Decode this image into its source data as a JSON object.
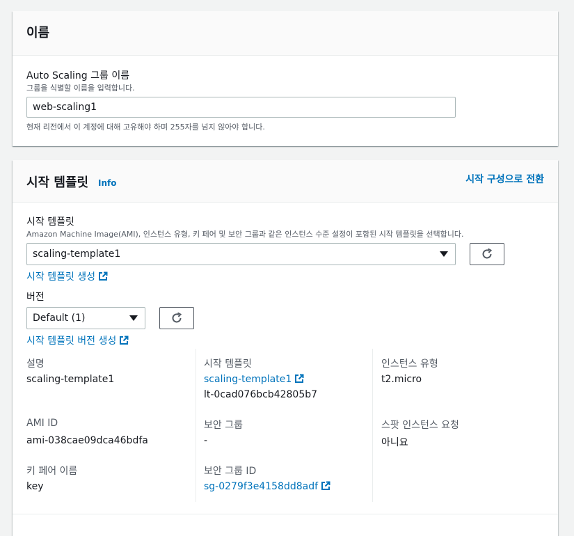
{
  "name_section": {
    "title": "이름",
    "asg_name_label": "Auto Scaling 그룹 이름",
    "asg_name_desc": "그룹을 식별할 이름을 입력합니다.",
    "asg_name_value": "web-scaling1",
    "asg_name_hint": "현재 리전에서 이 계정에 대해 고유해야 하며 255자를 넘지 않아야 합니다."
  },
  "template_section": {
    "title": "시작 템플릿",
    "info": "Info",
    "switch_link": "시작 구성으로 전환",
    "template_label": "시작 템플릿",
    "template_desc": "Amazon Machine Image(AMI), 인스턴스 유형, 키 페어 및 보안 그룹과 같은 인스턴스 수준 설정이 포함된 시작 템플릿을 선택합니다.",
    "template_selected": "scaling-template1",
    "create_template_link": "시작 템플릿 생성",
    "version_label": "버전",
    "version_selected": "Default (1)",
    "create_version_link": "시작 템플릿 버전 생성",
    "details": {
      "description_label": "설명",
      "description_value": "scaling-template1",
      "launch_template_label": "시작 템플릿",
      "launch_template_name": "scaling-template1",
      "launch_template_id": "lt-0cad076bcb42805b7",
      "instance_type_label": "인스턴스 유형",
      "instance_type_value": "t2.micro",
      "ami_id_label": "AMI ID",
      "ami_id_value": "ami-038cae09dca46bdfa",
      "security_group_label": "보안 그룹",
      "security_group_value": "-",
      "spot_request_label": "스팟 인스턴스 요청",
      "spot_request_value": "아니요",
      "key_pair_label": "키 페어 이름",
      "key_pair_value": "key",
      "security_group_id_label": "보안 그룹 ID",
      "security_group_id_value": "sg-0279f3e4158dd8adf"
    }
  },
  "colors": {
    "background": "#f2f3f3",
    "link": "#0073bb",
    "text": "#16191f",
    "muted": "#545b64"
  }
}
